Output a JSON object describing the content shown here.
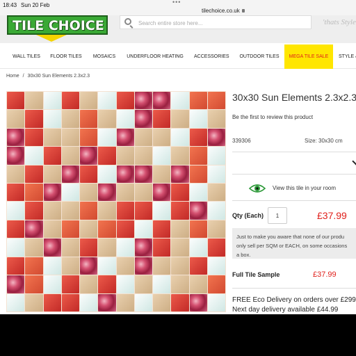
{
  "status_bar": {
    "time": "18:43",
    "date": "Sun 20 Feb",
    "dots": "•••",
    "url": "tilechoice.co.uk"
  },
  "header": {
    "logo_text": "TILE CHOICE",
    "search_placeholder": "Search entire store here...",
    "tagline": "'thats Style"
  },
  "nav": {
    "items": [
      "WALL TILES",
      "FLOOR TILES",
      "MOSAICS",
      "UNDERFLOOR HEATING",
      "ACCESSORIES",
      "OUTDOOR TILES",
      "MEGA TILE SALE",
      "STYLE &"
    ],
    "highlight_color": "#ffe600"
  },
  "breadcrumb": {
    "home": "Home",
    "separator": "/",
    "current": "30x30 Sun Elements 2.3x2.3"
  },
  "product": {
    "title": "30x30 Sun Elements 2.3x2.3",
    "review_text": "Be the first to review this product",
    "sku": "339306",
    "size": "Size: 30x30 cm",
    "view_room": "View this tile in your room",
    "qty_label": "Qty (Each)",
    "qty_value": "1",
    "price": "£37.99",
    "notice_line1": "Just to make you aware that none of our produ",
    "notice_line2": "only sell per SQM or EACH, on some occasions",
    "notice_line3": "a box.",
    "sample_label": "Full Tile Sample",
    "sample_price": "£37.99",
    "delivery_line1": "FREE Eco Delivery on orders over £299",
    "delivery_line2": "Next day delivery available £44.99",
    "price_color": "#e0201b"
  },
  "tile_pattern": [
    "rbwrbwrppwoo",
    "brwbobwprbwb",
    "prbbowpbbwrp",
    "pwrbprbbwbow",
    "brbprwppbpow",
    "ropwbpbbprwb",
    "wrbbobrrwrpw",
    "rpboborwrbob",
    "wbpbrbwprbwr",
    "rowbpwbpbbrw",
    "powrbrwbwbbo",
    "wbrrwpbwbrpw"
  ]
}
